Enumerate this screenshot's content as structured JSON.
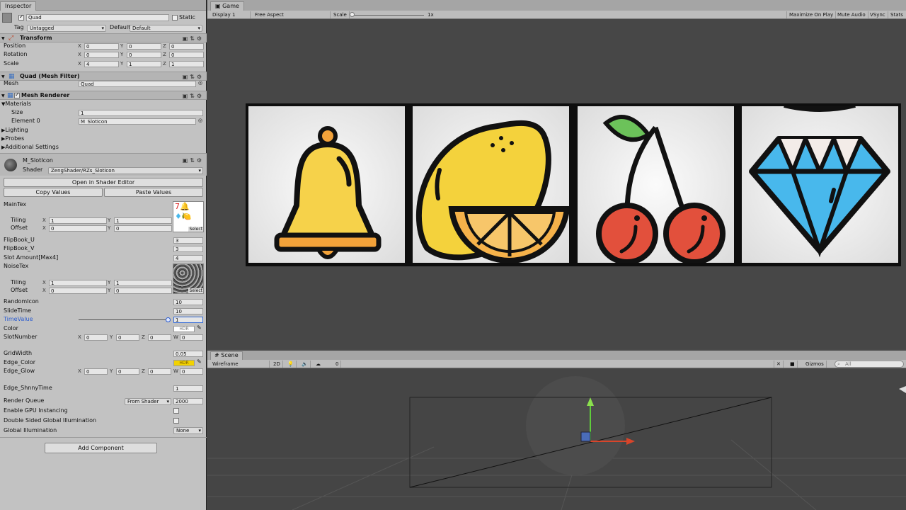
{
  "inspector": {
    "tab": "Inspector",
    "object_name": "Quad",
    "static_label": "Static",
    "tag_label": "Tag",
    "tag_value": "Untagged",
    "layer_label": "Layer",
    "layer_value": "Default",
    "transform": {
      "title": "Transform",
      "position_label": "Position",
      "position": [
        "0",
        "0",
        "0"
      ],
      "rotation_label": "Rotation",
      "rotation": [
        "0",
        "0",
        "0"
      ],
      "scale_label": "Scale",
      "scale": [
        "4",
        "1",
        "1"
      ]
    },
    "mesh_filter": {
      "title": "Quad (Mesh Filter)",
      "mesh_label": "Mesh",
      "mesh_value": "Quad"
    },
    "mesh_renderer": {
      "title": "Mesh Renderer",
      "materials": "Materials",
      "size_label": "Size",
      "size": "1",
      "element0_label": "Element 0",
      "element0": "M_SlotIcon",
      "lighting": "Lighting",
      "probes": "Probes",
      "additional": "Additional Settings"
    },
    "material": {
      "name": "M_SlotIcon",
      "shader_label": "Shader",
      "shader": "ZengShader/RZs_SlotIcon",
      "open_shader": "Open in Shader Editor",
      "copy": "Copy Values",
      "paste": "Paste Values",
      "maintex": "MainTex",
      "tiling": "Tiling",
      "offset": "Offset",
      "tiling_vals": [
        "1",
        "1"
      ],
      "offset_vals": [
        "0",
        "0"
      ],
      "select": "Select",
      "flipu_label": "FlipBook_U",
      "flipu": "3",
      "flipv_label": "FlipBook_V",
      "flipv": "3",
      "slotamount_label": "Slot Amount[Max4]",
      "slotamount": "4",
      "noisetex": "NoiseTex",
      "n_tiling_vals": [
        "1",
        "1"
      ],
      "n_offset_vals": [
        "0",
        "0"
      ],
      "randomicon_label": "RandomIcon",
      "randomicon": "10",
      "slidetime_label": "SlideTime",
      "slidetime": "10",
      "timevalue_label": "TimeValue",
      "timevalue": "1",
      "timevalue_fraction": 1.0,
      "color_label": "Color",
      "hdr": "HDR",
      "slotnumber_label": "SlotNumber",
      "slotnumber": [
        "0",
        "0",
        "0",
        "0"
      ],
      "gridwidth_label": "GridWidth",
      "gridwidth": "0.05",
      "edgecolor_label": "Edge_Color",
      "edgeglow_label": "Edge_Glow",
      "edgeglow": [
        "0",
        "0",
        "0",
        "0"
      ],
      "shinny_label": "Edge_ShnnyTime",
      "shinny": "1",
      "renderqueue_label": "Render Queue",
      "renderqueue_mode": "From Shader",
      "renderqueue": "2000",
      "gpu_label": "Enable GPU Instancing",
      "doublesided_label": "Double Sided Global Illumination",
      "gi_label": "Global Illumination",
      "gi_value": "None"
    },
    "add_component": "Add Component"
  },
  "game": {
    "tab": "Game",
    "display": "Display 1",
    "aspect": "Free Aspect",
    "scale_label": "Scale",
    "scale_value": "1x",
    "maximize": "Maximize On Play",
    "mute": "Mute Audio",
    "vsync": "VSync",
    "stats": "Stats"
  },
  "scene": {
    "tab": "Scene",
    "mode": "Wireframe",
    "twod": "2D",
    "fx_count": "0",
    "gizmos": "Gizmos",
    "search_placeholder": "All"
  },
  "colors": {
    "accent": "#3a6fd8",
    "edge_color": "#f2d200",
    "bell": "#f6d24a",
    "lemon": "#f4d23c",
    "cherry": "#e2503c",
    "diamond": "#48b8ec"
  }
}
